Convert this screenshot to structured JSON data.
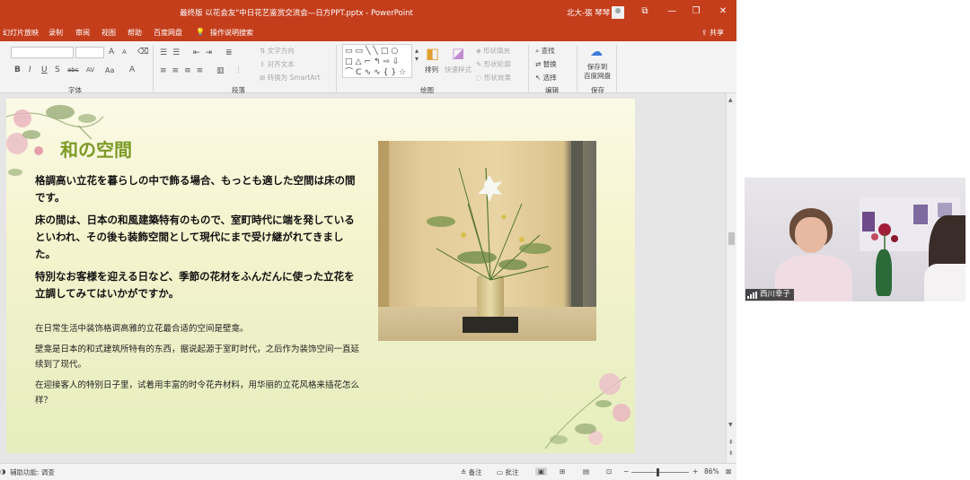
{
  "window": {
    "title": "最终版  以花会友\"中日花艺鉴赏交流会—日方PPT.pptx  -  PowerPoint",
    "user": "北大-張 琴琴",
    "controls": {
      "ribbon_display": "⧉",
      "minimize": "—",
      "restore": "❐",
      "close": "✕"
    },
    "title_bar_color": "#c43e1c"
  },
  "menu": {
    "items": [
      "幻灯片放映",
      "录制",
      "审阅",
      "视图",
      "帮助",
      "百度网盘"
    ],
    "search": "操作说明搜索",
    "share": "共享"
  },
  "ribbon": {
    "groups": {
      "font": "字体",
      "paragraph": "段落",
      "drawing": "绘图",
      "editing": "编辑",
      "save": "保存"
    },
    "font_buttons": [
      "B",
      "I",
      "U",
      "S",
      "abc",
      "AV",
      "Aa",
      "A"
    ],
    "paragraph": {
      "text_direction": "文字方向",
      "align_text": "对齐文本",
      "smartart": "转换为 SmartArt"
    },
    "drawing": {
      "arrange": "排列",
      "quick_styles": "快速样式",
      "shape_fill": "形状填充",
      "shape_outline": "形状轮廓",
      "shape_effects": "形状效果"
    },
    "editing": {
      "find": "查找",
      "replace": "替换",
      "select": "选择"
    },
    "save_to_baidu": "保存到\n百度网盘"
  },
  "slide": {
    "title": "和の空間",
    "jp_paragraphs": [
      "格調高い立花を暮らしの中で飾る場合、もっとも適した空間は床の間です。",
      "床の間は、日本の和風建築特有のもので、室町時代に端を発しているといわれ、その後も装飾空間として現代にまで受け継がれてきました。",
      "特別なお客様を迎える日など、季節の花材をふんだんに使った立花を立調してみてはいかがですか。"
    ],
    "cn_paragraphs": [
      "在日常生活中装饰格调高雅的立花最合适的空间是壁龛。",
      "壁龛是日本的和式建筑所特有的东西，据说起源于室町时代，之后作为装饰空间一直延续到了现代。",
      "在迎接客人的特别日子里，试着用丰富的时令花卉材料，用华丽的立花风格来插花怎么样？"
    ],
    "title_color": "#7b9a27"
  },
  "statusbar": {
    "accessibility": "辅助功能: 调查",
    "notes": "备注",
    "comments": "批注",
    "zoom": "86%"
  },
  "video": {
    "participant": "西川幸子"
  }
}
